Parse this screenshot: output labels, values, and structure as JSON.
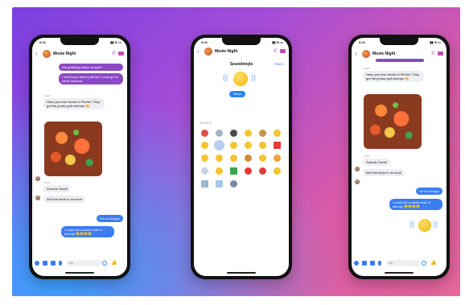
{
  "phones": {
    "left": {
      "time": "9:41",
      "chat_title": "Movie Night",
      "messages": {
        "m1": "We grabbing dinner tonight?",
        "m2": "I dont know about y'all but I could go for some seafood",
        "m3_sender": "Sarah",
        "m3": "Have you ever heard of Pêche? They got the jumbo gulf shrimps 🍤",
        "m4_sender": "Olivia",
        "m4": "Sounds Great!",
        "m5": "We'll be there in an hour!",
        "m6": "I'm so hungry!",
        "m7": "I could eat a whole boat of shrimp! 🤤🤤🤤🤤"
      },
      "composer_placeholder": "Aa"
    },
    "middle": {
      "time": "9:41",
      "chat_title": "Movie Night",
      "sheet_title": "Soundmojis",
      "done_label": "Done",
      "send_label": "Send",
      "sounds_label": "SOUNDS"
    },
    "right": {
      "time": "9:41",
      "chat_title": "Movie Night",
      "messages": {
        "m3_sender": "Sarah",
        "m3": "Have you ever heard of Pêche? They got the jumbo gulf shrimps 🍤",
        "m4_sender": "Olivia",
        "m4": "Sounds Great!",
        "m5": "We'll be there in an hour!",
        "m6": "I'm so hungry!",
        "m7": "I could eat a whole boat of shrimp! 🤤🤤🤤🤤"
      },
      "composer_placeholder": "Aa"
    }
  },
  "colors": {
    "bg_purple": "#7a3fe0",
    "bg_pink": "#e4669a",
    "bg_blue": "#3aa0ff",
    "bubble_purple": "#8c49c4",
    "bubble_blue": "#3a7ef0",
    "accent_blue": "#2a86f5"
  },
  "icons": [
    "back-chevron-icon",
    "phone-icon",
    "video-icon",
    "plus-icon",
    "camera-icon",
    "photo-icon",
    "mic-icon",
    "emoji-icon",
    "thumbs-up-icon",
    "sound-wave-icon"
  ]
}
